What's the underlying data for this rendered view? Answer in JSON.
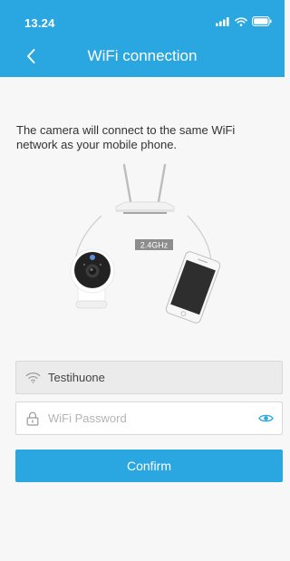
{
  "status_bar": {
    "time": "13.24"
  },
  "header": {
    "title": "WiFi connection"
  },
  "main": {
    "description": "The camera will connect to the same WiFi network as your mobile phone.",
    "illustration": {
      "band_label": "2.4GHz"
    },
    "ssid_field": {
      "value": "Testihuone"
    },
    "password_field": {
      "placeholder": "WiFi Password",
      "value": ""
    },
    "confirm_label": "Confirm"
  },
  "colors": {
    "accent": "#2aa6e0",
    "background": "#f7f7f7",
    "text": "#333333"
  },
  "icons": {
    "back": "chevron-left-icon",
    "wifi": "wifi-icon",
    "lock": "lock-icon",
    "eye": "eye-icon",
    "signal": "signal-icon",
    "battery": "battery-icon"
  }
}
